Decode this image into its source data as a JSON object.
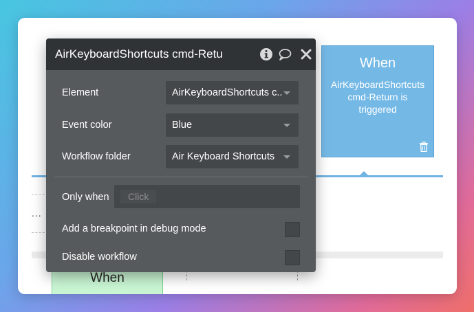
{
  "popup": {
    "title": "AirKeyboardShortcuts cmd-Retu",
    "icons": [
      "info-icon",
      "comment-icon",
      "close-icon"
    ],
    "fields": {
      "element": {
        "label": "Element",
        "value": "AirKeyboardShortcuts c..."
      },
      "event_color": {
        "label": "Event color",
        "value": "Blue"
      },
      "workflow_folder": {
        "label": "Workflow folder",
        "value": "Air Keyboard Shortcuts"
      }
    },
    "only_when": {
      "label": "Only when",
      "placeholder": "Click"
    },
    "breakpoint": {
      "label": "Add a breakpoint in debug mode",
      "checked": false
    },
    "disable": {
      "label": "Disable workflow",
      "checked": false
    }
  },
  "event_card": {
    "title": "When",
    "description": "AirKeyboardShortcuts cmd-Return is triggered",
    "color": "#74b9e6",
    "icon": "trash-icon"
  },
  "canvas": {
    "ellipsis": "...",
    "green_card_title": "When"
  },
  "colors": {
    "popup_bg": "#565a5c",
    "popup_header": "#2f3336",
    "connector": "#6fb2e4",
    "green_card": "#c9f5d3"
  }
}
